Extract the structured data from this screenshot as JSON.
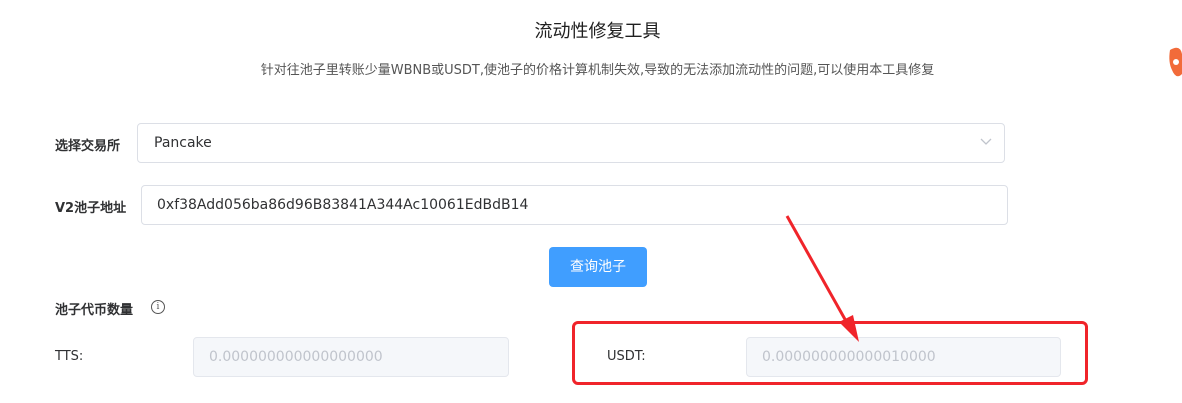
{
  "page": {
    "title": "流动性修复工具",
    "subtitle": "针对往池子里转账少量WBNB或USDT,使池子的价格计算机制失效,导致的无法添加流动性的问题,可以使用本工具修复"
  },
  "form": {
    "exchange_label": "选择交易所",
    "exchange_value": "Pancake",
    "pool_label": "V2池子地址",
    "pool_value": "0xf38Add056ba86d96B83841A344Ac10061EdBdB14",
    "query_button": "查询池子",
    "reserves_label": "池子代币数量",
    "token_a_label": "TTS:",
    "token_a_value": "0.000000000000000000",
    "token_b_label": "USDT:",
    "token_b_value": "0.000000000000010000"
  },
  "colors": {
    "primary": "#409eff",
    "annotation": "#f0242a"
  },
  "icons": {
    "select_caret": "chevron-down-icon",
    "reserves_info": "info-circle-icon"
  }
}
